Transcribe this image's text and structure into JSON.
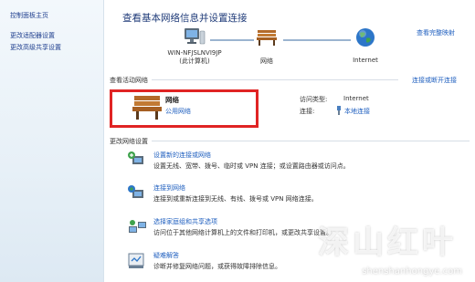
{
  "sidebar": {
    "items": [
      {
        "label": "控制面板主页"
      },
      {
        "label": "更改适配器设置"
      },
      {
        "label": "更改高级共享设置"
      }
    ]
  },
  "header": {
    "title": "查看基本网络信息并设置连接",
    "full_map": "查看完整映射"
  },
  "network_map": {
    "computer_name": "WIN-NFJSLNVI9JP",
    "computer_sub": "(此计算机)",
    "network_label": "网络",
    "internet_label": "Internet"
  },
  "active": {
    "heading": "查看活动网络",
    "connect_disconnect": "连接或断开连接",
    "network_name": "网络",
    "network_type": "公用网络",
    "access_type_label": "访问类型:",
    "access_type_value": "Internet",
    "connections_label": "连接:",
    "connections_value": "本地连接"
  },
  "change": {
    "heading": "更改网络设置",
    "tasks": [
      {
        "title": "设置新的连接或网络",
        "desc": "设置无线、宽带、拨号、临时或 VPN 连接；或设置路由器或访问点。"
      },
      {
        "title": "连接到网络",
        "desc": "连接到或重新连接到无线、有线、拨号或 VPN 网络连接。"
      },
      {
        "title": "选择家庭组和共享选项",
        "desc": "访问位于其他网络计算机上的文件和打印机，或更改共享设置。"
      },
      {
        "title": "疑难解答",
        "desc": "诊断并修复网络问题，或获得故障排除信息。"
      }
    ]
  },
  "watermark": {
    "main": "深山红叶",
    "url": "shenshanhongye.com"
  },
  "colors": {
    "link": "#1f5fbf",
    "highlight_box": "#e02424",
    "sidebar_bg": "#e7f0f7"
  }
}
